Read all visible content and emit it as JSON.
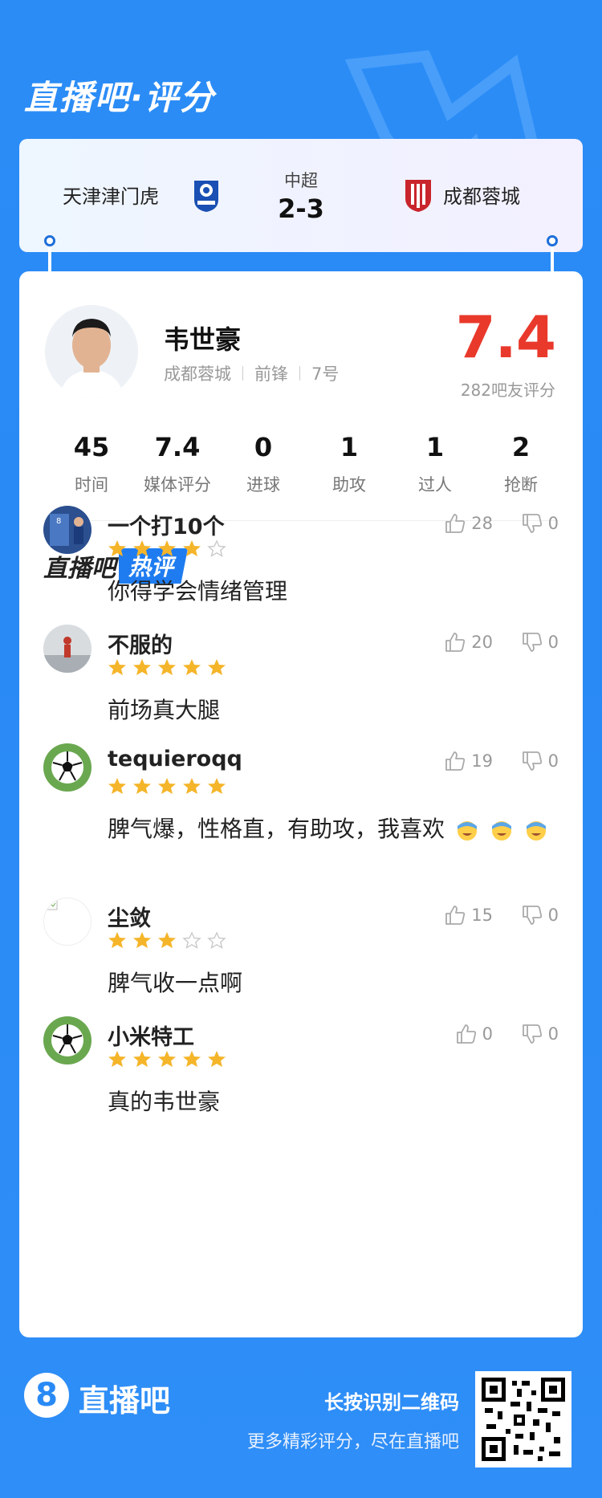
{
  "brand": {
    "title": "直播吧·评分"
  },
  "match": {
    "home_team": "天津津门虎",
    "away_team": "成都蓉城",
    "league": "中超",
    "score": "2-3"
  },
  "player": {
    "name": "韦世豪",
    "team": "成都蓉城",
    "position": "前锋",
    "number": "7号",
    "rating": "7.4",
    "rating_count": "282吧友评分"
  },
  "stats": [
    {
      "value": "45",
      "label": "时间"
    },
    {
      "value": "7.4",
      "label": "媒体评分"
    },
    {
      "value": "0",
      "label": "进球"
    },
    {
      "value": "1",
      "label": "助攻"
    },
    {
      "value": "1",
      "label": "过人"
    },
    {
      "value": "2",
      "label": "抢断"
    }
  ],
  "hot": {
    "part_a": "直播吧",
    "part_b": "热评"
  },
  "comments": [
    {
      "user": "一个打10个",
      "stars": 4,
      "text": "你得学会情绪管理",
      "likes": "28",
      "dislikes": "0"
    },
    {
      "user": "不服的",
      "stars": 5,
      "text": "前场真大腿",
      "likes": "20",
      "dislikes": "0"
    },
    {
      "user": "tequieroqq",
      "stars": 5,
      "text": "脾气爆，性格直，有助攻，我喜欢",
      "likes": "19",
      "dislikes": "0"
    },
    {
      "user": "尘敛",
      "stars": 3,
      "text": "脾气收一点啊",
      "likes": "15",
      "dislikes": "0"
    },
    {
      "user": "小米特工",
      "stars": 5,
      "text": "真的韦世豪",
      "likes": "0",
      "dislikes": "0"
    }
  ],
  "footer": {
    "logo_glyph": "8",
    "name": "直播吧",
    "cta": "长按识别二维码",
    "sub": "更多精彩评分，尽在直播吧"
  },
  "colors": {
    "accent": "#2a8af5",
    "rating": "#e8392b",
    "star": "#f5b52a"
  }
}
